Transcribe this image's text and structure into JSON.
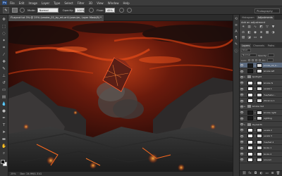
{
  "app": {
    "logo": "Ps"
  },
  "menu": [
    "File",
    "Edit",
    "Image",
    "Layer",
    "Type",
    "Select",
    "Filter",
    "3D",
    "View",
    "Window",
    "Help"
  ],
  "options": {
    "mode_label": "Mode:",
    "mode_value": "Normal",
    "opacity_label": "Opacity:",
    "opacity_value": "100%",
    "flow_label": "Flow:",
    "flow_value": "45%",
    "workspace": "Photography"
  },
  "document": {
    "tab_title": "FLayout tut 3% @ 25% (smoke_02_by_mt-art1(useu)m, Layer Mask/8) *"
  },
  "status": {
    "zoom": "25%",
    "doc_size": "Doc: 24.9M/1.31G"
  },
  "panels": {
    "top_tabs": [
      "Histogram",
      "Adjustments"
    ],
    "adjustments_title": "Add an adjustment",
    "adjustment_icons": [
      "sun-icon",
      "levels-icon",
      "curves-icon",
      "exposure-icon",
      "triangle-icon",
      "vibrance-icon",
      "balance-icon",
      "bw-icon",
      "camera-icon",
      "grid-icon",
      "lookup-icon",
      "invert-icon",
      "posterize-icon",
      "threshold-icon",
      "gradient-map-icon",
      "selective-color-icon"
    ],
    "layers_tabs": [
      "Layers",
      "Channels",
      "Paths"
    ],
    "kind_label": "Kind",
    "blend_mode": "Normal",
    "opacity_label": "Opacity:",
    "lock_label": "Lock:",
    "fill_label": "Fill:"
  },
  "layers": [
    {
      "name": "smoke_02_b...",
      "type": "image",
      "selected": true
    },
    {
      "name": "Smoke left",
      "type": "image",
      "selected": false
    },
    {
      "name": "Spotlight",
      "type": "group",
      "selected": false
    },
    {
      "name": "Smoke fx",
      "type": "adjust",
      "selected": false
    },
    {
      "name": "Levels 1",
      "type": "adjust",
      "selected": false
    },
    {
      "name": "Hue/Satur...",
      "type": "adjust",
      "selected": false
    },
    {
      "name": "Vibrance 1",
      "type": "adjust",
      "selected": false
    },
    {
      "name": "Smoke mid",
      "type": "group",
      "selected": false
    },
    {
      "name": "Smoke right",
      "type": "image",
      "selected": false
    },
    {
      "name": "Lighting",
      "type": "image",
      "selected": false
    },
    {
      "name": "Sky/earth",
      "type": "group",
      "selected": false
    },
    {
      "name": "Levels 2",
      "type": "adjust",
      "selected": false
    },
    {
      "name": "Levels 3",
      "type": "adjust",
      "selected": false
    },
    {
      "name": "Hue/Sat 2",
      "type": "adjust",
      "selected": false
    },
    {
      "name": "Rocks 1",
      "type": "adjust",
      "selected": false
    },
    {
      "name": "Rocks 2",
      "type": "adjust",
      "selected": false
    },
    {
      "name": "Ground",
      "type": "adjust",
      "selected": false
    }
  ]
}
